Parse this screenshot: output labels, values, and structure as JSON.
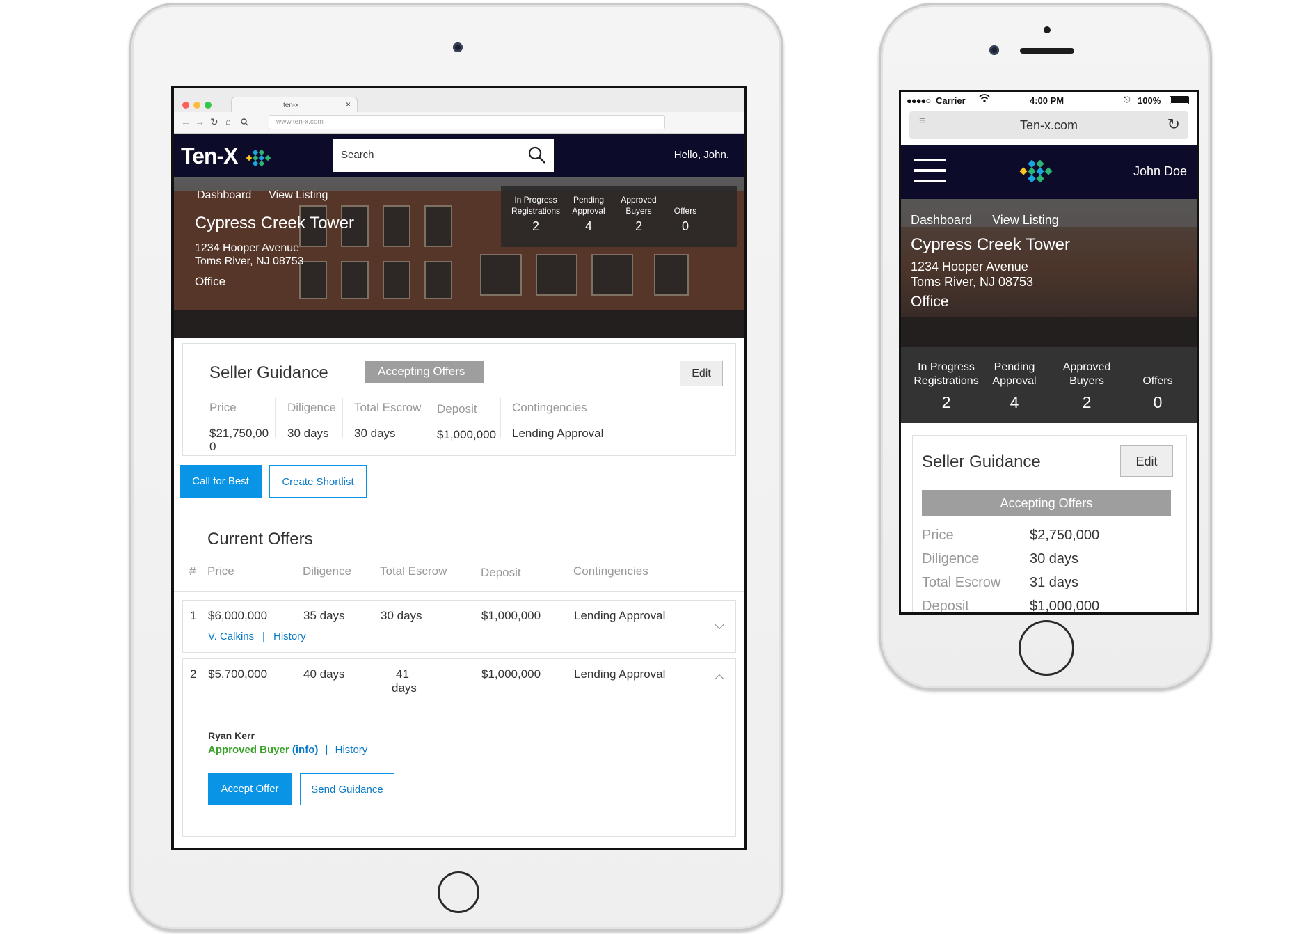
{
  "tablet": {
    "browser": {
      "tab_title": "ten-x",
      "tab_close": "×",
      "url": "www.ten-x.com"
    },
    "header": {
      "logo_text": "Ten-X",
      "search_placeholder": "Search",
      "greeting": "Hello, John."
    },
    "hero": {
      "nav": [
        "Dashboard",
        "View Listing"
      ],
      "title": "Cypress Creek Tower",
      "address_line1": "1234 Hooper Avenue",
      "address_line2": "Toms River, NJ 08753",
      "property_type": "Office"
    },
    "stats": [
      {
        "label_line1": "In Progress",
        "label_line2": "Registrations",
        "value": "2"
      },
      {
        "label_line1": "Pending",
        "label_line2": "Approval",
        "value": "4"
      },
      {
        "label_line1": "Approved",
        "label_line2": "Buyers",
        "value": "2"
      },
      {
        "label_line1": "",
        "label_line2": "Offers",
        "value": "0"
      }
    ],
    "seller_guidance": {
      "title": "Seller Guidance",
      "status_pill": "Accepting Offers",
      "edit_label": "Edit",
      "columns": [
        {
          "label": "Price",
          "value_line1": "$21,750,00",
          "value_line2": "0"
        },
        {
          "label": "Diligence",
          "value_line1": "30 days",
          "value_line2": ""
        },
        {
          "label": "Total Escrow",
          "value_line1": "30 days",
          "value_line2": ""
        },
        {
          "label": "Deposit",
          "value_line1": "$1,000,000",
          "value_line2": ""
        },
        {
          "label": "Contingencies",
          "value_line1": "Lending Approval",
          "value_line2": ""
        }
      ]
    },
    "actions": {
      "call_for_best": "Call for Best",
      "create_shortlist": "Create Shortlist"
    },
    "current_offers": {
      "title": "Current Offers",
      "headers": [
        "#",
        "Price",
        "Diligence",
        "Total Escrow",
        "Deposit",
        "Contingencies"
      ],
      "offers": [
        {
          "num": "1",
          "price": "$6,000,000",
          "diligence": "35 days",
          "escrow_line1": "30 days",
          "escrow_line2": "",
          "deposit": "$1,000,000",
          "contingencies": "Lending Approval",
          "buyer_link": "V. Calkins",
          "divider": "|",
          "history_link": "History"
        },
        {
          "num": "2",
          "price": "$5,700,000",
          "diligence": "40 days",
          "escrow_line1": "41",
          "escrow_line2": "days",
          "deposit": "$1,000,000",
          "contingencies": "Lending Approval"
        }
      ],
      "expanded": {
        "buyer_name": "Ryan Kerr",
        "buyer_status": "Approved Buyer",
        "info_link": "(info)",
        "divider": "|",
        "history_link": "History",
        "accept_label": "Accept Offer",
        "send_guidance_label": "Send Guidance"
      }
    }
  },
  "phone": {
    "status_bar": {
      "carrier": "Carrier",
      "time": "4:00 PM",
      "battery": "100%"
    },
    "url": "Ten-x.com",
    "header": {
      "user": "John Doe"
    },
    "hero": {
      "nav": [
        "Dashboard",
        "View Listing"
      ],
      "title": "Cypress Creek Tower",
      "address_line1": "1234 Hooper Avenue",
      "address_line2": "Toms River, NJ 08753",
      "property_type": "Office"
    },
    "stats": [
      {
        "label_line1": "In Progress",
        "label_line2": "Registrations",
        "value": "2"
      },
      {
        "label_line1": "Pending",
        "label_line2": "Approval",
        "value": "4"
      },
      {
        "label_line1": "Approved",
        "label_line2": "Buyers",
        "value": "2"
      },
      {
        "label_line1": "",
        "label_line2": "Offers",
        "value": "0"
      }
    ],
    "seller_guidance": {
      "title": "Seller Guidance",
      "edit_label": "Edit",
      "status_pill": "Accepting Offers",
      "rows": [
        {
          "label": "Price",
          "value": "$2,750,000"
        },
        {
          "label": "Diligence",
          "value": "30 days"
        },
        {
          "label": "Total Escrow",
          "value": "31 days"
        },
        {
          "label": "Deposit",
          "value": "$1,000,000"
        }
      ]
    }
  },
  "colors": {
    "nav_dark": "#0c0c2a",
    "accent_blue": "#0a94e6",
    "link_blue": "#0a7ac8",
    "approved_green": "#3aa12a",
    "pill_gray": "#9e9e9e"
  }
}
